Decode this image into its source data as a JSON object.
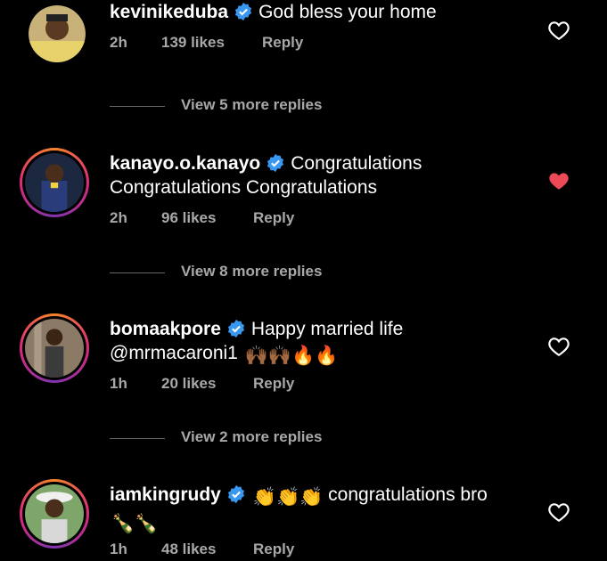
{
  "comments": [
    {
      "username": "kevinikeduba",
      "text": "God bless your home",
      "time": "2h",
      "likes": "139 likes",
      "reply": "Reply",
      "liked": false,
      "view_more": "View 5 more replies"
    },
    {
      "username": "kanayo.o.kanayo",
      "text_line1": "Congratulations",
      "text_line2": "Congratulations Congratulations",
      "time": "2h",
      "likes": "96 likes",
      "reply": "Reply",
      "liked": true,
      "view_more": "View 8 more replies"
    },
    {
      "username": "bomaakpore",
      "text_line1": "Happy married life",
      "text_line2": "@mrmacaroni1",
      "emoji": "🙌🏾🙌🏾🔥🔥",
      "time": "1h",
      "likes": "20 likes",
      "reply": "Reply",
      "liked": false,
      "view_more": "View 2 more replies"
    },
    {
      "username": "iamkingrudy",
      "emoji_prefix": "👏👏👏",
      "text": "congratulations bro",
      "emoji_line2": "🍾🍾",
      "time": "1h",
      "likes": "48 likes",
      "reply": "Reply",
      "liked": false
    }
  ],
  "colors": {
    "background": "#000000",
    "text": "#ffffff",
    "muted": "#a8a8a8",
    "verified": "#3897f0",
    "heart_liked": "#ed4956"
  }
}
